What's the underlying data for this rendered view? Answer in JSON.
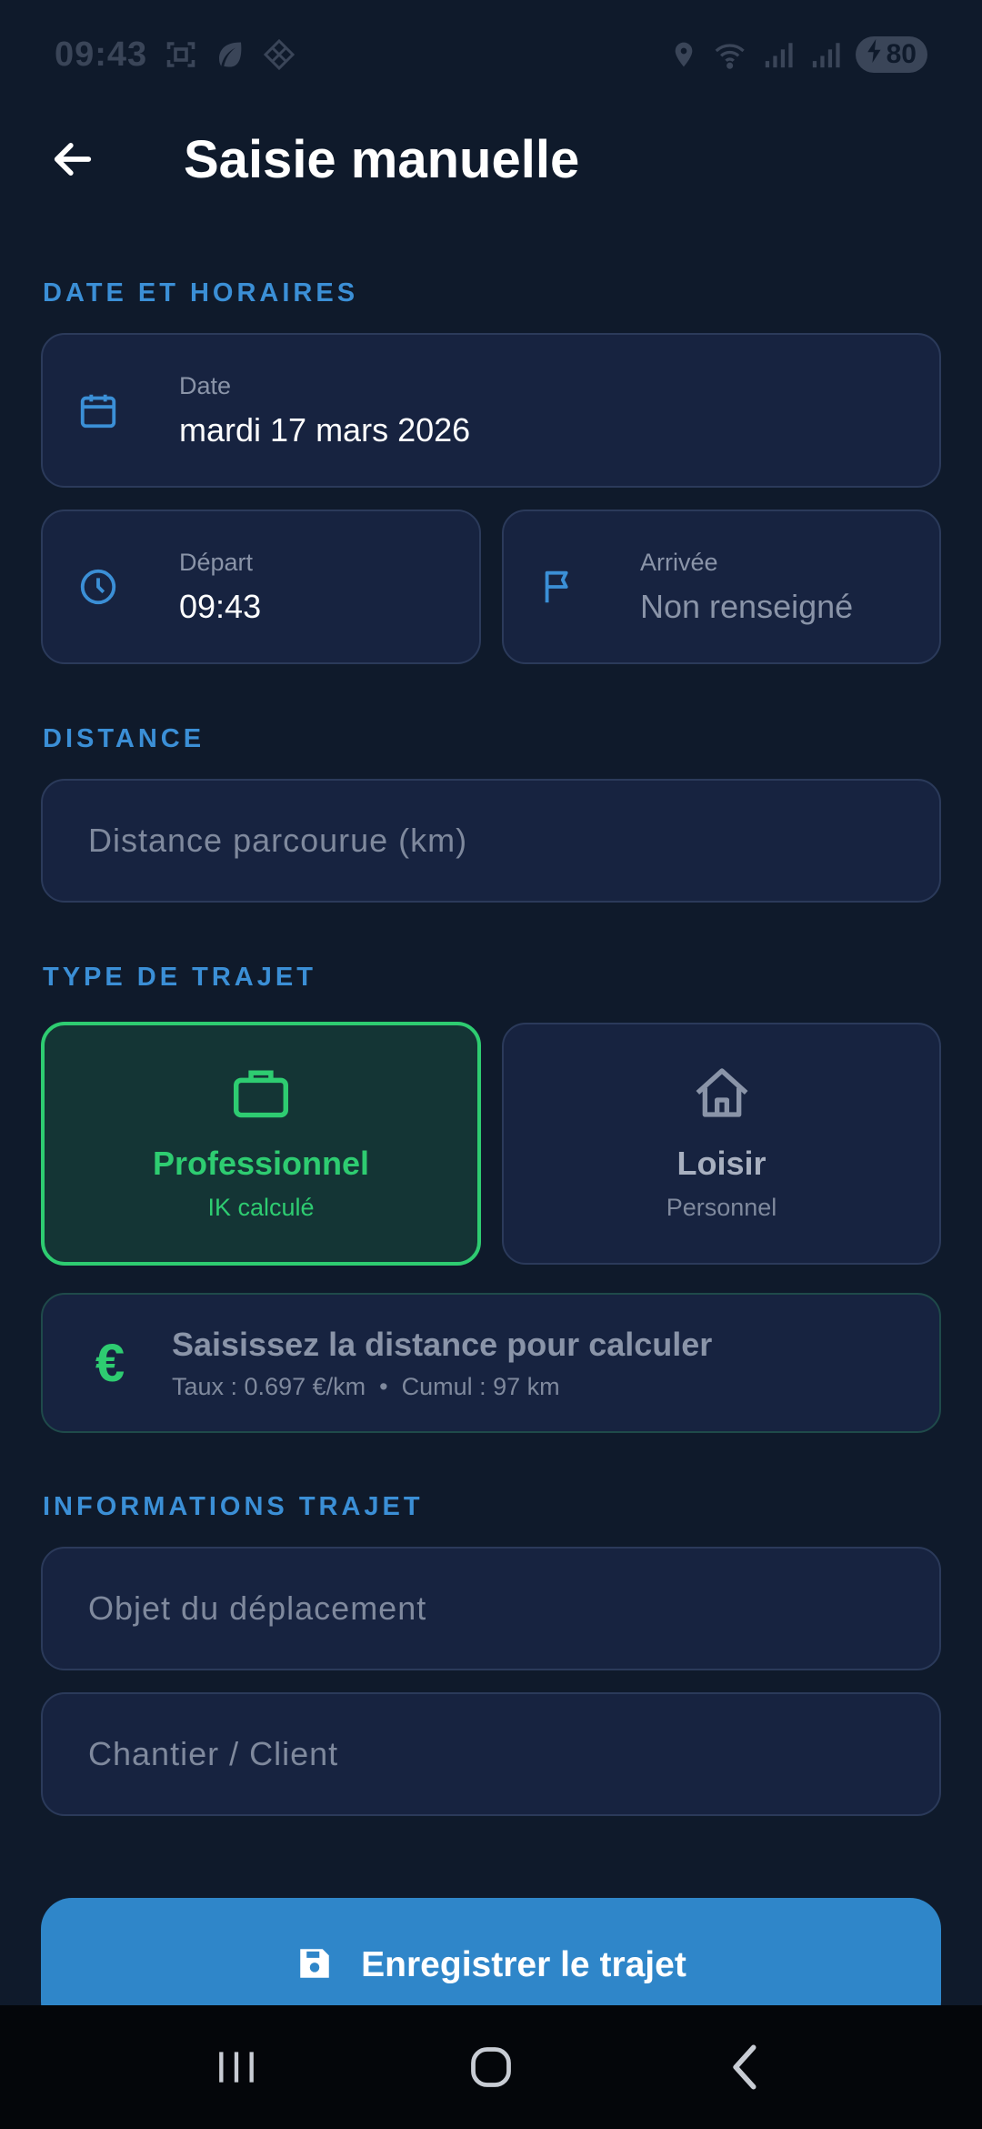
{
  "status_bar": {
    "time": "09:43",
    "battery": "80",
    "icons_left": [
      "screenshot-icon",
      "leaf-icon",
      "diamond-grid-icon"
    ],
    "icons_right": [
      "location-icon",
      "wifi-icon",
      "signal-icon",
      "signal-icon"
    ]
  },
  "header": {
    "title": "Saisie manuelle",
    "back_icon": "arrow-left-icon"
  },
  "sections": {
    "date_times": "DATE ET HORAIRES",
    "distance": "DISTANCE",
    "trip_type": "TYPE DE TRAJET",
    "trip_info": "INFORMATIONS TRAJET"
  },
  "date_field": {
    "label": "Date",
    "value": "mardi 17 mars 2026",
    "icon": "calendar-icon"
  },
  "departure_field": {
    "label": "Départ",
    "value": "09:43",
    "icon": "clock-icon"
  },
  "arrival_field": {
    "label": "Arrivée",
    "value": "Non renseigné",
    "icon": "flag-icon"
  },
  "distance_input": {
    "placeholder": "Distance parcourue (km)"
  },
  "trip_types": [
    {
      "title": "Professionnel",
      "subtitle": "IK calculé",
      "icon": "briefcase-icon",
      "selected": true
    },
    {
      "title": "Loisir",
      "subtitle": "Personnel",
      "icon": "home-icon",
      "selected": false
    }
  ],
  "ik_info": {
    "symbol": "€",
    "title": "Saisissez la distance pour calculer",
    "details": "Taux : 0.697 €/km  •  Cumul : 97 km"
  },
  "purpose_input": {
    "placeholder": "Objet du déplacement"
  },
  "client_input": {
    "placeholder": "Chantier / Client"
  },
  "save_button": {
    "label": "Enregistrer le trajet",
    "icon": "save-icon"
  },
  "colors": {
    "background": "#0f1a2b",
    "card": "#172340",
    "accent_blue": "#3b8fd6",
    "accent_green": "#2ecc71",
    "button": "#2f86c9"
  }
}
